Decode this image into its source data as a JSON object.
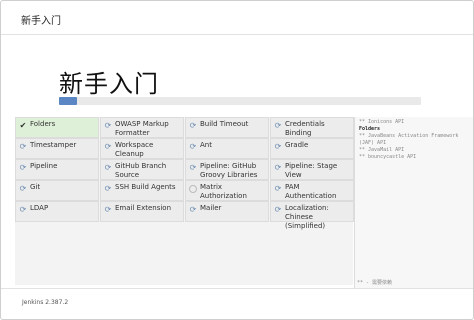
{
  "window": {
    "title": "新手入门"
  },
  "hero": {
    "title": "新手入门",
    "progress_fraction": 0.05
  },
  "plugins": [
    [
      {
        "label": "Folders",
        "status": "done"
      },
      {
        "label": "OWASP Markup Formatter",
        "status": "installing"
      },
      {
        "label": "Build Timeout",
        "status": "installing"
      },
      {
        "label": "Credentials Binding",
        "status": "installing"
      }
    ],
    [
      {
        "label": "Timestamper",
        "status": "installing"
      },
      {
        "label": "Workspace Cleanup",
        "status": "installing"
      },
      {
        "label": "Ant",
        "status": "installing"
      },
      {
        "label": "Gradle",
        "status": "installing"
      }
    ],
    [
      {
        "label": "Pipeline",
        "status": "installing"
      },
      {
        "label": "GitHub Branch Source",
        "status": "installing"
      },
      {
        "label": "Pipeline: GitHub Groovy Libraries",
        "status": "installing"
      },
      {
        "label": "Pipeline: Stage View",
        "status": "installing"
      }
    ],
    [
      {
        "label": "Git",
        "status": "installing"
      },
      {
        "label": "SSH Build Agents",
        "status": "installing"
      },
      {
        "label": "Matrix Authorization Strategy",
        "status": "pending"
      },
      {
        "label": "PAM Authentication",
        "status": "installing"
      }
    ],
    [
      {
        "label": "LDAP",
        "status": "installing"
      },
      {
        "label": "Email Extension",
        "status": "installing"
      },
      {
        "label": "Mailer",
        "status": "installing"
      },
      {
        "label": "Localization: Chinese (Simplified)",
        "status": "installing"
      }
    ]
  ],
  "log": {
    "lines": [
      "** Ionicons API",
      "Folders",
      "** JavaBeans Activation Framework (JAF) API",
      "** JavaMail API",
      "** bouncycastle API"
    ],
    "footer": "** - 需要依赖"
  },
  "footer": {
    "version": "Jenkins 2.387.2"
  },
  "colors": {
    "selected": "#dff0d8",
    "progress": "#5b86c4",
    "icon": "#6a8bb0"
  },
  "icons": {
    "done": "check-icon",
    "installing": "refresh-icon",
    "pending": "circle-icon"
  }
}
